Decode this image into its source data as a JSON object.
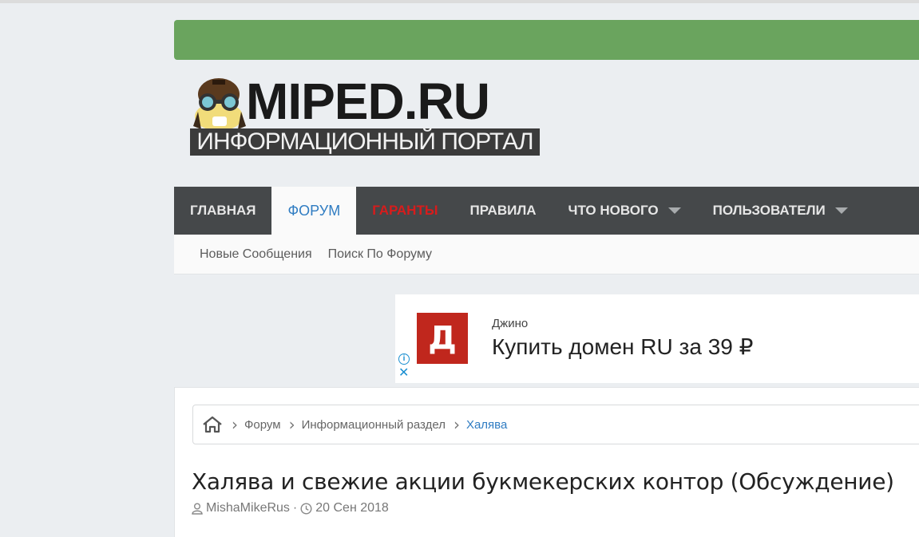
{
  "brand": {
    "logo_text": "MIPED.RU",
    "logo_subtitle": "ИНФОРМАЦИОННЫЙ ПОРТАЛ"
  },
  "nav": {
    "items": [
      {
        "label": "Главная"
      },
      {
        "label": "Форум"
      },
      {
        "label": "Гаранты"
      },
      {
        "label": "Правила"
      },
      {
        "label": "Что нового"
      },
      {
        "label": "Пользователи"
      }
    ],
    "active_color": "#2f7cc2",
    "highlight_color": "#d71c1c"
  },
  "subnav": {
    "items": [
      {
        "label": "Новые Сообщения"
      },
      {
        "label": "Поиск По Форуму"
      }
    ]
  },
  "ad": {
    "logo_letter": "Д",
    "brand": "Джино",
    "title": "Купить домен RU за 39 ₽"
  },
  "breadcrumb": {
    "items": [
      {
        "label": "Форум"
      },
      {
        "label": "Информационный раздел"
      },
      {
        "label": "Халява"
      }
    ]
  },
  "thread": {
    "title": "Халява и свежие акции букмекерских контор (Обсуждение)",
    "author": "MishaMikeRus",
    "date": "20 Сен 2018"
  },
  "colors": {
    "green_bar": "#6aa45e",
    "nav_bg": "#45484a"
  }
}
